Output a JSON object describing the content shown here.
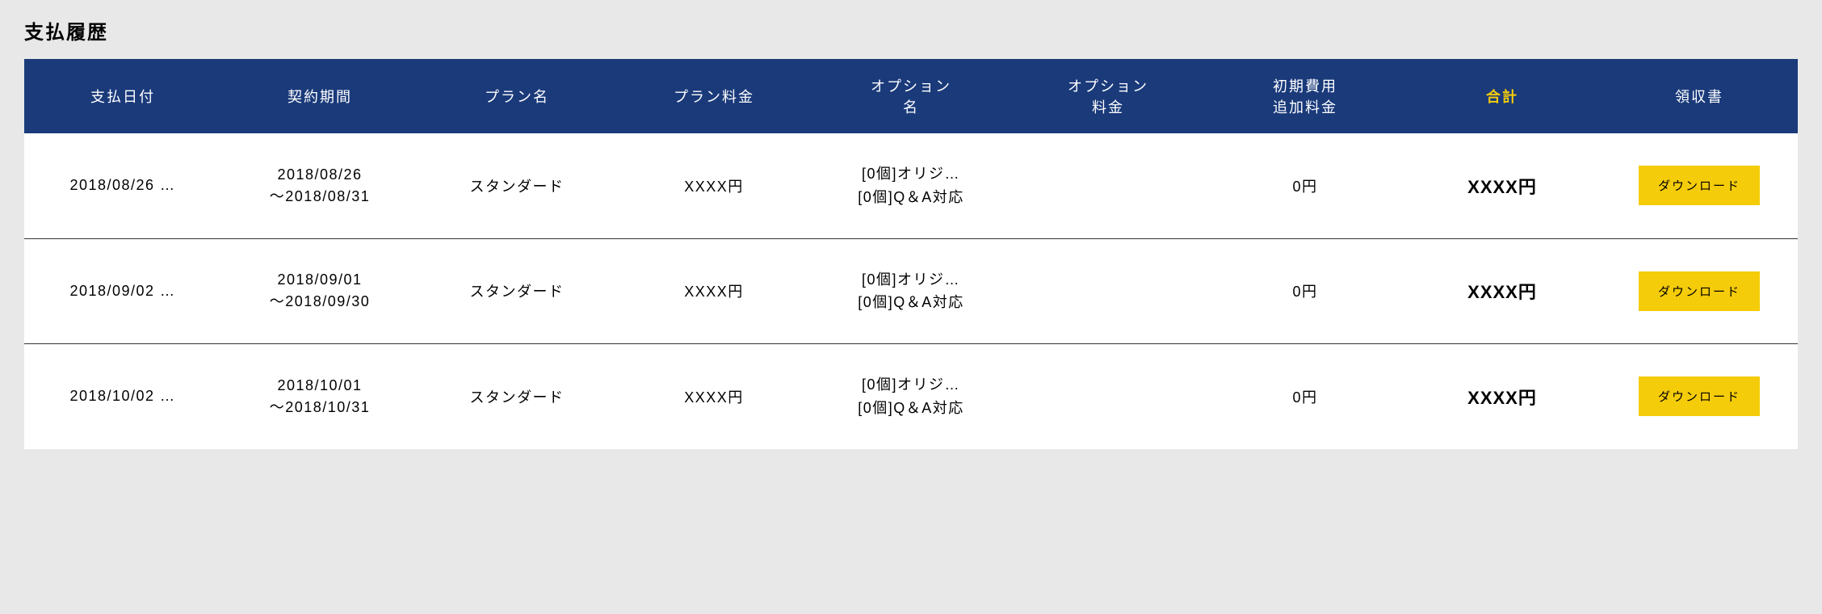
{
  "page_title": "支払履歴",
  "headers": {
    "payment_date": "支払日付",
    "contract_period": "契約期間",
    "plan_name": "プラン名",
    "plan_fee": "プラン料金",
    "option_name_line1": "オプション",
    "option_name_line2": "名",
    "option_fee_line1": "オプション",
    "option_fee_line2": "料金",
    "initial_fee_line1": "初期費用",
    "initial_fee_line2": "追加料金",
    "total": "合計",
    "receipt": "領収書"
  },
  "rows": [
    {
      "payment_date": "2018/08/26 …",
      "period_line1": "2018/08/26",
      "period_line2": "〜2018/08/31",
      "plan_name": "スタンダード",
      "plan_fee": "XXXX円",
      "option_name_line1": "[0個]オリジ…",
      "option_name_line2": "[0個]Q＆A対応",
      "option_fee": "",
      "initial_fee": "0円",
      "total": "XXXX円",
      "download_label": "ダウンロード"
    },
    {
      "payment_date": "2018/09/02 …",
      "period_line1": "2018/09/01",
      "period_line2": "〜2018/09/30",
      "plan_name": "スタンダード",
      "plan_fee": "XXXX円",
      "option_name_line1": "[0個]オリジ…",
      "option_name_line2": "[0個]Q＆A対応",
      "option_fee": "",
      "initial_fee": "0円",
      "total": "XXXX円",
      "download_label": "ダウンロード"
    },
    {
      "payment_date": "2018/10/02 …",
      "period_line1": "2018/10/01",
      "period_line2": "〜2018/10/31",
      "plan_name": "スタンダード",
      "plan_fee": "XXXX円",
      "option_name_line1": "[0個]オリジ…",
      "option_name_line2": "[0個]Q＆A対応",
      "option_fee": "",
      "initial_fee": "0円",
      "total": "XXXX円",
      "download_label": "ダウンロード"
    }
  ]
}
